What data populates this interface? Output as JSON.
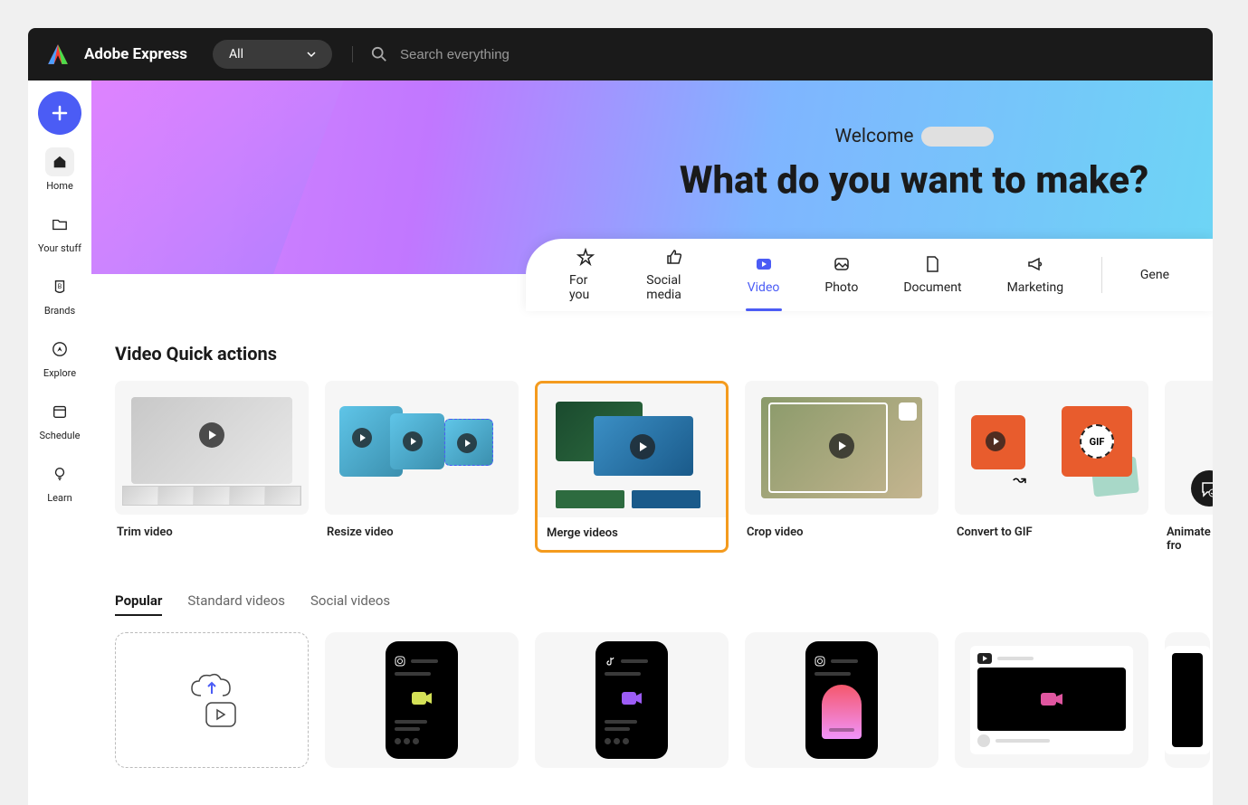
{
  "header": {
    "app_name": "Adobe Express",
    "filter_selected": "All",
    "search_placeholder": "Search everything"
  },
  "sidebar": {
    "items": [
      {
        "label": "Home",
        "icon": "home",
        "active": true
      },
      {
        "label": "Your stuff",
        "icon": "folder"
      },
      {
        "label": "Brands",
        "icon": "brand"
      },
      {
        "label": "Explore",
        "icon": "compass"
      },
      {
        "label": "Schedule",
        "icon": "calendar"
      },
      {
        "label": "Learn",
        "icon": "bulb"
      }
    ]
  },
  "hero": {
    "welcome_text": "Welcome",
    "title": "What do you want to make?"
  },
  "category_tabs": [
    {
      "label": "For you",
      "icon": "star"
    },
    {
      "label": "Social media",
      "icon": "thumbsup"
    },
    {
      "label": "Video",
      "icon": "play",
      "active": true
    },
    {
      "label": "Photo",
      "icon": "photo"
    },
    {
      "label": "Document",
      "icon": "doc"
    },
    {
      "label": "Marketing",
      "icon": "megaphone"
    },
    {
      "label": "Gene",
      "icon": "none"
    }
  ],
  "quick_actions": {
    "title": "Video Quick actions",
    "cards": [
      {
        "label": "Trim video"
      },
      {
        "label": "Resize video"
      },
      {
        "label": "Merge videos",
        "highlight": true
      },
      {
        "label": "Crop video"
      },
      {
        "label": "Convert to GIF",
        "gif_badge": "GIF"
      },
      {
        "label": "Animate fro"
      }
    ]
  },
  "template_tabs": [
    {
      "label": "Popular",
      "active": true
    },
    {
      "label": "Standard videos"
    },
    {
      "label": "Social videos"
    }
  ]
}
